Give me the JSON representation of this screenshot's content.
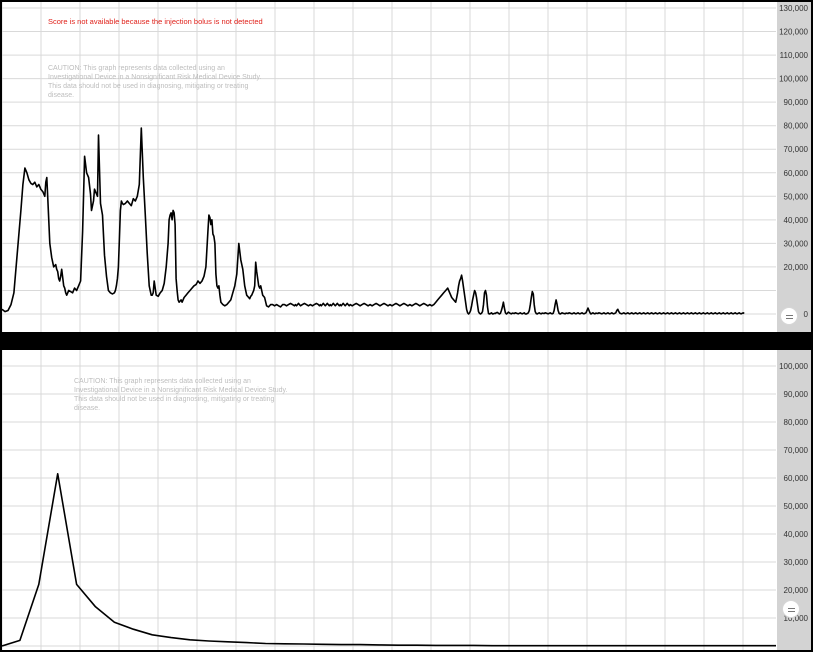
{
  "top_panel": {
    "warning": "Score is not available because the injection bolus is not detected",
    "caution": "CAUTION: This graph represents data collected using an Investigational Device in a Nonsignificant Risk Medical Device Study. This data should not be used in diagnosing, mitigating or treating disease."
  },
  "bottom_panel": {
    "caution": "CAUTION: This graph represents data collected using an Investigational Device in a Nonsignificant Risk Medical Device Study. This data should not be used in diagnosing, mitigating or treating disease."
  },
  "colors": {
    "line": "#000000",
    "grid": "#d9d9d9",
    "axis_band": "#d3d3d3",
    "warning": "#e0221b",
    "caution": "#bdbdbd"
  },
  "chart_data": [
    {
      "type": "line",
      "name": "top",
      "ylim": [
        0,
        130000
      ],
      "y_ticks": [
        0,
        10000,
        20000,
        30000,
        40000,
        50000,
        60000,
        70000,
        80000,
        90000,
        100000,
        110000,
        120000,
        130000
      ],
      "y_tick_labels": [
        "0",
        "",
        "20,000",
        "30,000",
        "40,000",
        "50,000",
        "60,000",
        "70,000",
        "80,000",
        "90,000",
        "100,000",
        "110,000",
        "120,000",
        "130,000"
      ],
      "grid": true,
      "x": [
        0,
        3,
        6,
        9,
        12,
        15,
        18,
        19,
        21,
        23,
        25,
        27,
        29,
        31,
        33,
        35,
        37,
        39,
        41,
        43,
        44,
        45,
        46,
        48,
        50,
        52,
        54,
        55,
        56,
        57,
        58,
        59,
        60,
        62,
        63,
        64,
        65,
        67,
        69,
        71,
        73,
        75,
        77,
        79,
        81,
        83,
        85,
        87,
        89,
        90,
        91,
        92,
        93,
        94,
        95,
        96,
        97,
        99,
        101,
        103,
        105,
        107,
        109,
        111,
        113,
        114,
        115,
        116,
        117,
        118,
        119,
        120,
        121,
        122,
        124,
        126,
        128,
        130,
        132,
        134,
        136,
        138,
        140,
        142,
        144,
        146,
        148,
        150,
        151,
        152,
        153,
        154,
        155,
        157,
        159,
        161,
        163,
        165,
        167,
        168,
        169,
        170,
        171,
        172,
        173,
        174,
        175,
        176,
        177,
        178,
        179,
        180,
        181,
        183,
        185,
        187,
        189,
        191,
        193,
        195,
        197,
        199,
        201,
        203,
        205,
        207,
        208,
        209,
        210,
        211,
        212,
        213,
        214,
        215,
        216,
        217,
        218,
        219,
        220,
        222,
        224,
        226,
        228,
        230,
        232,
        234,
        236,
        238,
        240,
        242,
        244,
        246,
        248,
        249,
        250,
        251,
        252,
        253,
        254,
        255,
        256,
        257,
        258,
        259,
        260,
        261,
        262,
        263,
        264,
        266,
        268,
        270,
        272,
        274,
        276,
        278,
        280,
        282,
        284,
        286,
        288,
        290,
        292,
        294,
        295,
        296,
        297,
        298,
        299,
        300,
        302,
        304,
        306,
        308,
        310,
        312,
        314,
        316,
        318,
        319,
        320,
        321,
        322,
        323,
        324,
        325,
        326,
        327,
        328,
        329,
        330,
        331,
        332,
        333,
        334,
        335,
        336,
        337,
        338,
        339,
        340,
        341,
        342,
        343,
        344,
        345,
        346,
        347,
        348,
        349,
        350,
        352,
        354,
        356,
        358,
        360,
        362,
        364,
        366,
        368,
        370,
        372,
        374,
        376,
        378,
        380,
        382,
        384,
        386,
        388,
        390,
        392,
        394,
        396,
        398,
        400,
        402,
        404,
        406,
        408,
        410,
        412,
        414,
        416,
        418,
        420,
        422,
        424,
        426,
        428,
        430,
        432,
        434,
        436,
        438,
        440,
        442,
        444,
        446,
        448,
        450,
        452,
        454,
        456,
        457,
        458,
        459,
        460,
        461,
        462,
        463,
        464,
        465,
        466,
        467,
        468,
        469,
        470,
        471,
        472,
        473,
        474,
        475,
        476,
        477,
        478,
        479,
        480,
        481,
        482,
        483,
        484,
        485,
        486,
        487,
        488,
        489,
        490,
        491,
        492,
        493,
        494,
        495,
        496,
        497,
        498,
        499,
        500,
        501,
        502,
        503,
        504,
        505,
        506,
        507,
        508,
        509,
        510,
        511,
        512,
        513,
        514,
        515,
        516,
        517,
        518,
        519,
        520,
        521,
        522,
        523,
        524,
        525,
        526,
        527,
        528,
        529,
        530,
        531,
        532,
        533,
        534,
        535,
        536,
        537,
        538,
        539,
        540,
        541,
        542,
        543,
        544,
        545,
        546,
        547,
        548,
        549,
        550,
        551,
        552,
        553,
        554,
        555,
        556,
        557,
        558,
        559,
        560,
        561,
        562,
        563,
        564,
        565,
        566,
        567,
        568,
        569,
        570,
        571,
        572,
        573,
        574,
        575,
        576,
        577,
        578,
        579,
        580,
        581,
        582,
        583,
        584,
        585,
        586,
        587,
        588,
        589,
        590,
        591,
        592,
        593,
        594,
        595,
        596,
        597,
        598,
        599,
        600,
        601,
        602,
        603,
        604,
        605,
        606,
        607,
        608,
        609,
        610,
        611,
        612,
        613,
        614,
        615,
        616,
        617,
        618,
        619,
        620,
        621,
        622,
        623,
        624,
        625,
        626,
        627,
        628,
        629,
        630,
        631,
        632,
        633,
        634,
        635,
        636,
        637,
        638,
        639,
        640,
        641,
        642,
        643,
        644,
        645,
        646,
        647,
        648,
        649,
        650,
        651,
        652,
        653,
        654,
        655,
        656,
        657,
        658,
        659,
        660,
        661,
        662,
        663,
        664,
        665,
        666,
        667,
        668,
        669,
        670,
        671,
        672,
        673,
        674,
        675,
        676,
        677,
        678,
        679,
        680,
        681,
        682,
        683,
        684,
        685,
        686,
        687,
        688,
        689,
        690,
        691,
        692,
        693,
        694,
        695,
        696,
        697,
        698,
        699,
        700,
        701,
        702,
        703,
        704,
        705,
        706,
        707,
        708,
        709,
        710,
        711,
        712,
        713,
        714,
        715,
        716,
        717,
        718,
        719,
        720,
        721,
        722,
        723,
        724,
        725,
        726,
        727,
        728,
        729,
        730,
        731,
        732,
        733,
        734,
        735,
        736,
        737,
        738,
        739,
        740,
        741,
        742,
        743,
        744,
        745,
        746,
        747,
        748,
        749,
        750,
        751,
        752,
        753,
        754,
        755,
        756,
        757,
        758,
        759,
        760,
        761,
        762,
        763,
        764,
        765,
        766,
        767,
        768,
        769,
        770,
        771,
        772,
        773,
        774,
        775,
        776,
        777,
        778
      ],
      "y": [
        2000,
        1000,
        1500,
        4000,
        9000,
        24000,
        39000,
        44000,
        55000,
        62000,
        60000,
        57000,
        55500,
        55000,
        56000,
        54000,
        55000,
        53000,
        52000,
        50000,
        56000,
        58000,
        49000,
        30000,
        24000,
        20000,
        21000,
        19000,
        18000,
        15000,
        14000,
        16000,
        19000,
        12000,
        11000,
        9000,
        8000,
        10000,
        9500,
        9000,
        11000,
        10000,
        12000,
        14000,
        35000,
        67000,
        60000,
        58000,
        51000,
        44000,
        46000,
        48000,
        53000,
        52000,
        51000,
        50000,
        76000,
        47000,
        42000,
        25000,
        16000,
        10000,
        9000,
        8500,
        9000,
        10000,
        12000,
        15000,
        20000,
        32000,
        44000,
        48000,
        47000,
        46500,
        47000,
        48000,
        47000,
        46000,
        49000,
        48000,
        50000,
        55000,
        79000,
        58000,
        42000,
        26000,
        12000,
        8000,
        8000,
        9000,
        14000,
        11000,
        8000,
        7500,
        9000,
        10000,
        13000,
        20000,
        30000,
        40000,
        42000,
        43000,
        40000,
        44000,
        43000,
        38000,
        15000,
        10000,
        6000,
        5000,
        5500,
        6000,
        5000,
        7000,
        8000,
        9000,
        10000,
        11000,
        12000,
        12500,
        14000,
        13000,
        14000,
        16000,
        20000,
        35000,
        42000,
        41000,
        38000,
        40000,
        34000,
        33000,
        30000,
        17000,
        12000,
        11000,
        12000,
        8000,
        5000,
        4000,
        3500,
        4000,
        5000,
        6000,
        9000,
        12000,
        17000,
        30000,
        23000,
        19000,
        12000,
        8000,
        7000,
        6500,
        7500,
        8000,
        9000,
        10000,
        12000,
        22000,
        18000,
        15000,
        12000,
        11000,
        12000,
        10000,
        8000,
        7500,
        7000,
        3500,
        3000,
        4000,
        4000,
        3500,
        4000,
        3500,
        3000,
        4000,
        4000,
        3500,
        4000,
        4500,
        4000,
        3500,
        4000,
        3500,
        4000,
        4500,
        4000,
        3500,
        4000,
        4500,
        4000,
        3500,
        4000,
        3500,
        4000,
        4500,
        4000,
        3500,
        4000,
        3500,
        4000,
        4500,
        4000,
        3500,
        4000,
        4500,
        4000,
        3500,
        4000,
        3500,
        4000,
        4500,
        4000,
        3500,
        4000,
        4500,
        4000,
        3500,
        4000,
        3500,
        4000,
        4500,
        4000,
        3500,
        4000,
        4500,
        4000,
        3500,
        4000,
        3500,
        4000,
        4500,
        4000,
        3500,
        4000,
        4500,
        4000,
        3500,
        4000,
        3500,
        4000,
        4500,
        4000,
        3500,
        4000,
        4500,
        4000,
        3500,
        4000,
        3500,
        4000,
        4500,
        4000,
        3500,
        4000,
        4500,
        4000,
        3500,
        4000,
        3500,
        4000,
        4500,
        4000,
        3500,
        4000,
        4500,
        4000,
        3500,
        4000,
        3500,
        4000,
        5000,
        6000,
        7000,
        8000,
        9000,
        10000,
        11000,
        9000,
        7000,
        6000,
        5000,
        7000,
        9000,
        12000,
        14000,
        15000,
        16500,
        14000,
        11000,
        8000,
        5000,
        2000,
        500,
        0,
        500,
        1500,
        3500,
        6000,
        8000,
        10000,
        9000,
        7000,
        4000,
        1000,
        300,
        0,
        300,
        1000,
        4000,
        9000,
        10000,
        8000,
        3000,
        200,
        0,
        200,
        500,
        0,
        100,
        300,
        200,
        600,
        700,
        300,
        0,
        300,
        1500,
        3000,
        5000,
        2500,
        500,
        0,
        300,
        800,
        500,
        200,
        100,
        400,
        300,
        200,
        500,
        400,
        200,
        100,
        300,
        500,
        200,
        100,
        300,
        500,
        0,
        0,
        200,
        500,
        1500,
        4000,
        7000,
        9500,
        8500,
        4000,
        1000,
        200,
        0,
        300,
        500,
        200,
        100,
        400,
        300,
        200,
        500,
        400,
        200,
        100,
        300,
        500,
        200,
        100,
        300,
        1500,
        4000,
        6000,
        4000,
        1500,
        300,
        0,
        200,
        500,
        300,
        200,
        100,
        400,
        300,
        200,
        500,
        400,
        200,
        100,
        300,
        500,
        200,
        100,
        300,
        500,
        200,
        100,
        300,
        500,
        200,
        100,
        300,
        500,
        1500,
        2500,
        1500,
        500,
        0,
        300,
        500,
        200,
        100,
        400,
        300,
        200,
        500,
        400,
        200,
        100,
        300,
        500,
        200,
        100,
        300,
        500,
        200,
        100,
        300,
        500,
        200,
        100,
        300,
        500,
        1500,
        2000,
        1000,
        400,
        200,
        100,
        300,
        500,
        200,
        100,
        300,
        500,
        200,
        100,
        300,
        500,
        200,
        100,
        300,
        500,
        200,
        100,
        300,
        500,
        200,
        100,
        300,
        500,
        200,
        100,
        300,
        500,
        200,
        100,
        300,
        500,
        200,
        100,
        300,
        500,
        200,
        100,
        300,
        500,
        200,
        100,
        300,
        500,
        200,
        100,
        300,
        500,
        200,
        100,
        300,
        500,
        200,
        100,
        300,
        500,
        200,
        100,
        300,
        500,
        200,
        100,
        300,
        500,
        200,
        100,
        300,
        500,
        200,
        100,
        300,
        500,
        200,
        100,
        300,
        500,
        200,
        100,
        300,
        500,
        200,
        100,
        300,
        500,
        200,
        100,
        300,
        500,
        200,
        100,
        300,
        500,
        200,
        100,
        300,
        500,
        200,
        100,
        300,
        500,
        200,
        100,
        300,
        500,
        200,
        100,
        300,
        500,
        200,
        100,
        300,
        500,
        200,
        100,
        300,
        500,
        200,
        100,
        300,
        500,
        200,
        100,
        300,
        500,
        200
      ]
    },
    {
      "type": "line",
      "name": "bottom",
      "ylim": [
        0,
        105000
      ],
      "y_ticks": [
        0,
        10000,
        20000,
        30000,
        40000,
        50000,
        60000,
        70000,
        80000,
        90000,
        100000
      ],
      "y_tick_labels": [
        "",
        "10,000",
        "20,000",
        "30,000",
        "40,000",
        "50,000",
        "60,000",
        "70,000",
        "80,000",
        "90,000",
        "100,000"
      ],
      "grid": true,
      "x": [
        0,
        18,
        37,
        56,
        75,
        94,
        113,
        132,
        151,
        170,
        189,
        208,
        227,
        246,
        265,
        284,
        303,
        322,
        341,
        360,
        379,
        398,
        417,
        436,
        455,
        474,
        493,
        512,
        531,
        550,
        569,
        588,
        607,
        626,
        645,
        664,
        683,
        702,
        721,
        740,
        759,
        778
      ],
      "y": [
        0,
        2000,
        22000,
        61500,
        22000,
        14000,
        8500,
        6000,
        4000,
        3000,
        2200,
        1800,
        1500,
        1200,
        900,
        800,
        700,
        600,
        500,
        500,
        400,
        300,
        300,
        200,
        200,
        200,
        100,
        100,
        100,
        100,
        100,
        100,
        100,
        100,
        100,
        100,
        100,
        100,
        100,
        100,
        100,
        100
      ]
    }
  ]
}
